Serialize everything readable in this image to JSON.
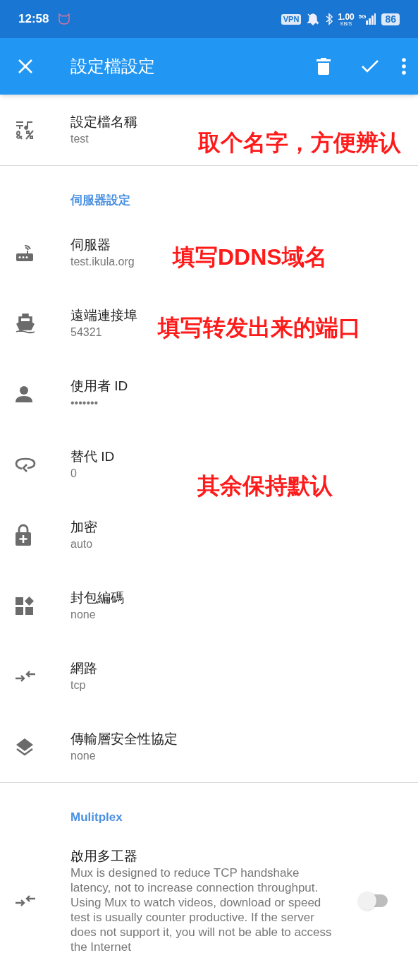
{
  "status_bar": {
    "time": "12:58",
    "vpn": "VPN",
    "speed": "1.00",
    "speed_unit": "KB/S",
    "network": "5G",
    "battery": "86"
  },
  "toolbar": {
    "title": "設定檔設定"
  },
  "sections": [
    {
      "rows": [
        {
          "kind": "field",
          "title": "設定檔名稱",
          "value": "test",
          "annotation": "取个名字，方便辨认"
        }
      ]
    },
    {
      "header": "伺服器設定",
      "rows": [
        {
          "kind": "field",
          "title": "伺服器",
          "value": "test.ikula.org",
          "annotation": "填写DDNS域名"
        },
        {
          "kind": "field",
          "title": "遠端連接埠",
          "value": "54321",
          "annotation": "填写转发出来的端口"
        },
        {
          "kind": "field",
          "title": "使用者 ID",
          "value": "•••••••"
        },
        {
          "kind": "field",
          "title": "替代 ID",
          "value": "0",
          "annotation": "其余保持默认"
        },
        {
          "kind": "field",
          "title": "加密",
          "value": "auto"
        },
        {
          "kind": "field",
          "title": "封包編碼",
          "value": "none"
        },
        {
          "kind": "field",
          "title": "網路",
          "value": "tcp"
        },
        {
          "kind": "field",
          "title": "傳輸層安全性協定",
          "value": "none"
        }
      ]
    },
    {
      "header": "Mulitplex",
      "rows": [
        {
          "kind": "switch",
          "title": "啟用多工器",
          "value": "Mux is designed to reduce TCP handshake latency, not to increase connection throughput. Using Mux to watch videos, download or speed test is usually counter productive. If the server does not support it, you will not be able to access the Internet",
          "on": false
        }
      ]
    }
  ]
}
